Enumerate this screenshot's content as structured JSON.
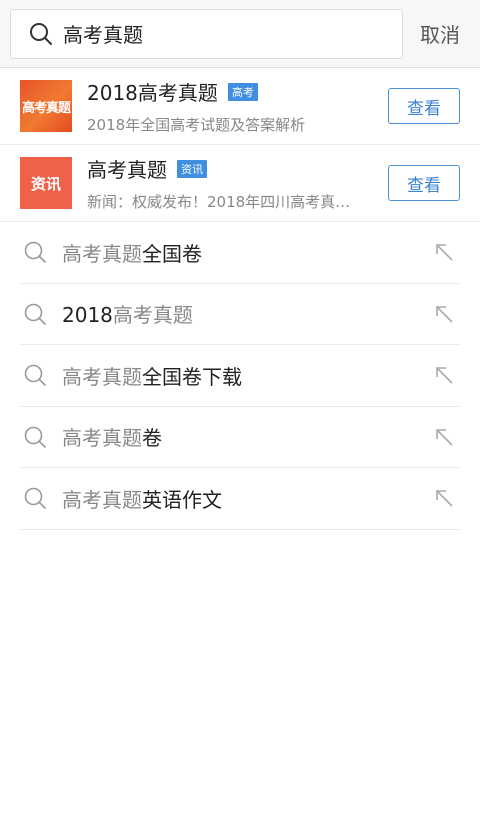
{
  "search": {
    "value": "高考真题",
    "cancel_label": "取消"
  },
  "cards": [
    {
      "thumb_text": "高考真题",
      "title": "2018高考真题",
      "badge": "高考",
      "subtitle": "2018年全国高考试题及答案解析",
      "button": "查看"
    },
    {
      "thumb_text": "资讯",
      "title": "高考真题",
      "badge": "资讯",
      "subtitle": "新闻：权威发布！2018年四川高考真…",
      "button": "查看"
    }
  ],
  "suggestions": [
    {
      "prefix": "高考真题",
      "suffix": "全国卷"
    },
    {
      "prefix": "2018",
      "prefix_dark": true,
      "suffix": "高考真题",
      "suffix_light": true
    },
    {
      "prefix": "高考真题",
      "suffix": "全国卷下载"
    },
    {
      "prefix": "高考真题",
      "suffix": "卷"
    },
    {
      "prefix": "高考真题",
      "suffix": "英语作文"
    }
  ],
  "colors": {
    "accent": "#3b82d1",
    "badge": "#3f8ee0",
    "thumb_red": "#f0614a"
  },
  "icons": {
    "search": "search-icon",
    "fill_arrow": "arrow-up-left-icon"
  }
}
